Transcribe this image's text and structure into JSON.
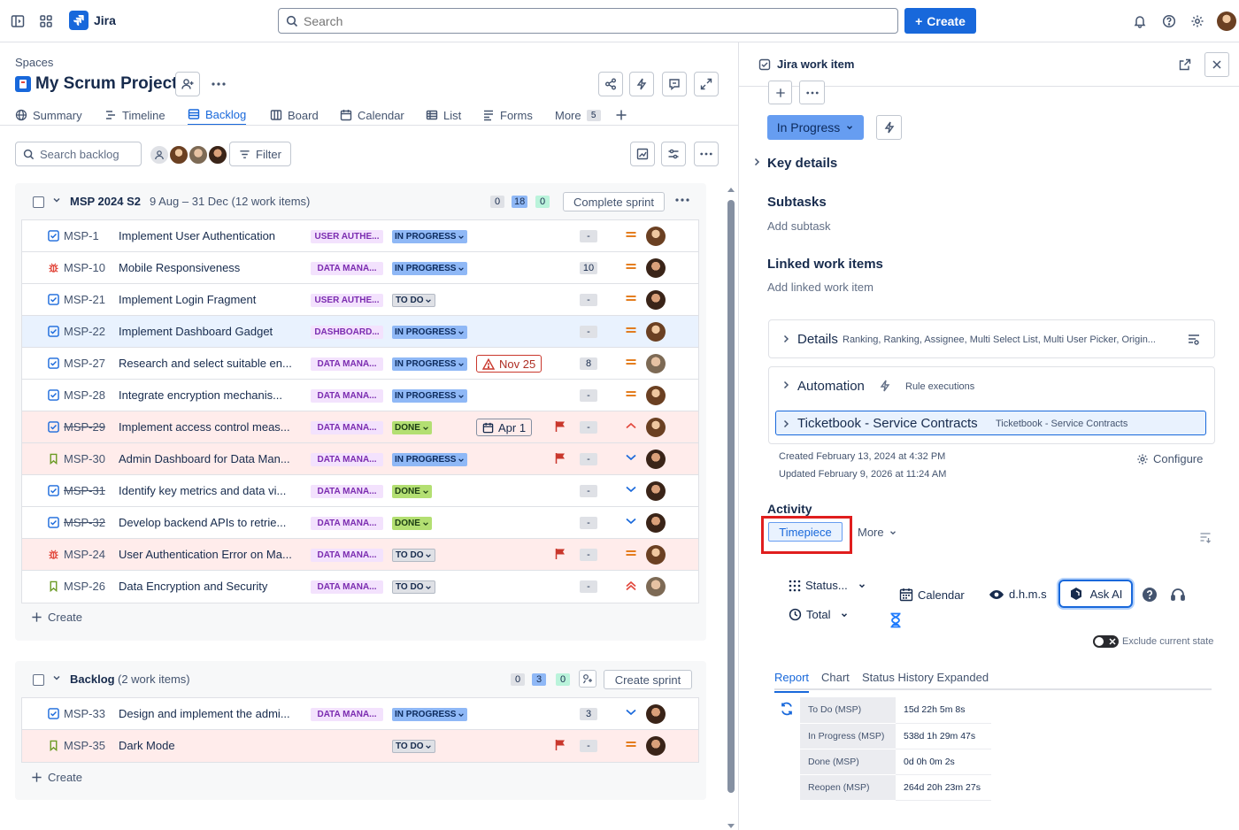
{
  "topnav": {
    "app_name": "Jira",
    "search_placeholder": "Search",
    "create_label": "Create"
  },
  "project": {
    "breadcrumb": "Spaces",
    "title": "My Scrum Project"
  },
  "tabs": [
    {
      "label": "Summary"
    },
    {
      "label": "Timeline"
    },
    {
      "label": "Backlog",
      "active": true
    },
    {
      "label": "Board"
    },
    {
      "label": "Calendar"
    },
    {
      "label": "List"
    },
    {
      "label": "Forms"
    },
    {
      "label": "More",
      "badge": "5"
    }
  ],
  "toolbar": {
    "search_placeholder": "Search backlog",
    "filter_label": "Filter"
  },
  "sprint": {
    "name": "MSP 2024 S2",
    "dates": "9 Aug – 31 Dec (12 work items)",
    "counts": [
      "0",
      "18",
      "0"
    ],
    "complete_label": "Complete sprint",
    "create_label": "Create",
    "rows": [
      {
        "type": "task",
        "key": "MSP-1",
        "summary": "Implement User Authentication",
        "epic": "USER AUTHE...",
        "status": "IN PROGRESS",
        "est": "-",
        "priority": "medium",
        "avatar": "a",
        "done": false
      },
      {
        "type": "bug",
        "key": "MSP-10",
        "summary": "Mobile Responsiveness",
        "epic": "DATA MANA...",
        "status": "IN PROGRESS",
        "est": "10",
        "priority": "medium",
        "avatar": "b",
        "done": false
      },
      {
        "type": "task",
        "key": "MSP-21",
        "summary": "Implement Login Fragment",
        "epic": "USER AUTHE...",
        "status": "TO DO",
        "est": "-",
        "priority": "medium",
        "avatar": "b",
        "done": false
      },
      {
        "type": "task",
        "key": "MSP-22",
        "summary": "Implement Dashboard Gadget",
        "epic": "DASHBOARD...",
        "status": "IN PROGRESS",
        "est": "-",
        "priority": "medium",
        "avatar": "a",
        "done": false,
        "selected": true
      },
      {
        "type": "task",
        "key": "MSP-27",
        "summary": "Research and select suitable en...",
        "epic": "DATA MANA...",
        "status": "IN PROGRESS",
        "date": "Nov 25",
        "overdue": true,
        "est": "8",
        "priority": "medium",
        "avatar": "c",
        "done": false
      },
      {
        "type": "task",
        "key": "MSP-28",
        "summary": "Integrate encryption mechanis...",
        "epic": "DATA MANA...",
        "status": "IN PROGRESS",
        "est": "-",
        "priority": "medium",
        "avatar": "a",
        "done": false
      },
      {
        "type": "task",
        "key": "MSP-29",
        "summary": "Implement access control meas...",
        "epic": "DATA MANA...",
        "status": "DONE",
        "date": "Apr 1",
        "flag": true,
        "est": "-",
        "priority": "high",
        "avatar": "a",
        "done": true,
        "red": true
      },
      {
        "type": "story",
        "key": "MSP-30",
        "summary": "Admin Dashboard for Data Man...",
        "epic": "DATA MANA...",
        "status": "IN PROGRESS",
        "flag": true,
        "est": "-",
        "priority": "low",
        "avatar": "b",
        "done": false,
        "red": true
      },
      {
        "type": "task",
        "key": "MSP-31",
        "summary": "Identify key metrics and data vi...",
        "epic": "DATA MANA...",
        "status": "DONE",
        "est": "-",
        "priority": "low",
        "avatar": "b",
        "done": true
      },
      {
        "type": "task",
        "key": "MSP-32",
        "summary": "Develop backend APIs to retrie...",
        "epic": "DATA MANA...",
        "status": "DONE",
        "est": "-",
        "priority": "low",
        "avatar": "b",
        "done": true
      },
      {
        "type": "bug",
        "key": "MSP-24",
        "summary": "User Authentication Error on Ma...",
        "epic": "DATA MANA...",
        "status": "TO DO",
        "flag": true,
        "est": "-",
        "priority": "medium",
        "avatar": "a",
        "done": false,
        "red": true
      },
      {
        "type": "story",
        "key": "MSP-26",
        "summary": "Data Encryption and Security",
        "epic": "DATA MANA...",
        "status": "TO DO",
        "est": "-",
        "priority": "highest",
        "avatar": "c",
        "done": false
      }
    ]
  },
  "backlog": {
    "name": "Backlog",
    "count_text": "(2 work items)",
    "counts": [
      "0",
      "3",
      "0"
    ],
    "create_sprint_label": "Create sprint",
    "create_label": "Create",
    "rows": [
      {
        "type": "task",
        "key": "MSP-33",
        "summary": "Design and implement the admi...",
        "epic": "DATA MANA...",
        "status": "IN PROGRESS",
        "est": "3",
        "priority": "low",
        "avatar": "b",
        "done": false
      },
      {
        "type": "story",
        "key": "MSP-35",
        "summary": "Dark Mode",
        "epic": "",
        "status": "TO DO",
        "flag": true,
        "est": "-",
        "priority": "medium",
        "avatar": "b",
        "done": false,
        "red": true
      }
    ]
  },
  "panel": {
    "title": "Jira work item",
    "status_label": "In Progress",
    "key_details": "Key details",
    "subtasks": "Subtasks",
    "add_subtask": "Add subtask",
    "linked": "Linked work items",
    "add_linked": "Add linked work item",
    "details_title": "Details",
    "details_sub": "Ranking, Ranking, Assignee, Multi Select List, Multi User Picker, Origin...",
    "automation_title": "Automation",
    "automation_sub": "Rule executions",
    "ticketbook_title": "Ticketbook - Service Contracts",
    "ticketbook_sub": "Ticketbook - Service Contracts",
    "created": "Created February 13, 2024 at 4:32 PM",
    "updated": "Updated February 9, 2026 at 11:24 AM",
    "configure": "Configure",
    "activity": "Activity",
    "timepiece": "Timepiece",
    "more": "More"
  },
  "timepiece": {
    "status_label": "Status...",
    "calendar_label": "Calendar",
    "format_label": "d.h.m.s",
    "ask_ai_label": "Ask AI",
    "total_label": "Total",
    "exclude_label": "Exclude current state",
    "tabs": [
      "Report",
      "Chart",
      "Status History Expanded"
    ],
    "report": [
      {
        "status": "To Do (MSP)",
        "time": "15d 22h 5m 8s"
      },
      {
        "status": "In Progress (MSP)",
        "time": "538d 1h 29m 47s"
      },
      {
        "status": "Done (MSP)",
        "time": "0d 0h 0m 2s"
      },
      {
        "status": "Reopen (MSP)",
        "time": "264d 20h 23m 27s"
      }
    ]
  }
}
